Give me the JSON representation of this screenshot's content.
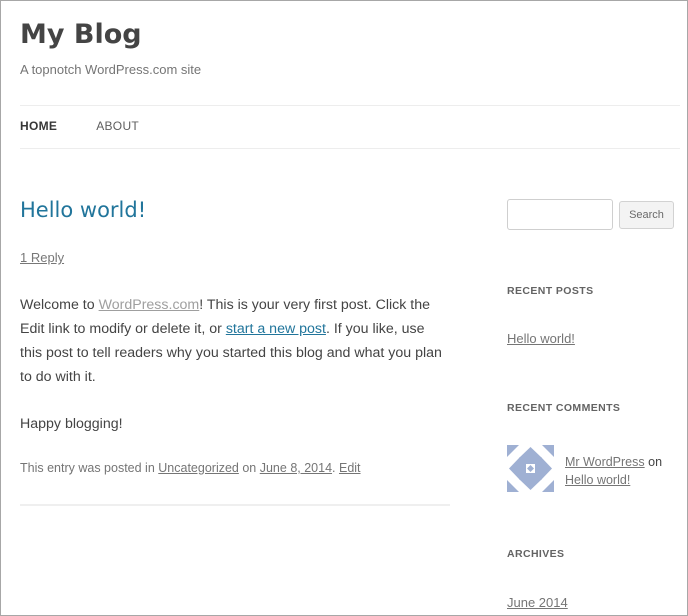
{
  "site": {
    "title": "My Blog",
    "description": "A topnotch WordPress.com site"
  },
  "nav": {
    "items": [
      {
        "label": "HOME",
        "current": true
      },
      {
        "label": "ABOUT",
        "current": false
      }
    ]
  },
  "post": {
    "title": "Hello world!",
    "reply_link": "1 Reply",
    "paragraph1": {
      "before": "Welcome to ",
      "link1": "WordPress.com",
      "middle": "! This is your very first post. Click the Edit link to modify or delete it, or ",
      "link2": "start a new post",
      "after": ". If you like, use this post to tell readers why you started this blog and what you plan to do with it."
    },
    "paragraph2": "Happy blogging!",
    "meta": {
      "prefix": "This entry was posted in ",
      "category": "Uncategorized",
      "on": " on ",
      "date": "June 8, 2014",
      "dot": ". ",
      "edit": "Edit"
    }
  },
  "sidebar": {
    "search_button": "Search",
    "recent_posts": {
      "title": "RECENT POSTS",
      "items": [
        "Hello world!"
      ]
    },
    "recent_comments": {
      "title": "RECENT COMMENTS",
      "author": "Mr WordPress",
      "on": " on ",
      "post": "Hello world!"
    },
    "archives": {
      "title": "ARCHIVES",
      "items": [
        "June 2014"
      ]
    }
  },
  "colors": {
    "link_blue": "#21759b",
    "text": "#444444",
    "muted": "#757575"
  }
}
